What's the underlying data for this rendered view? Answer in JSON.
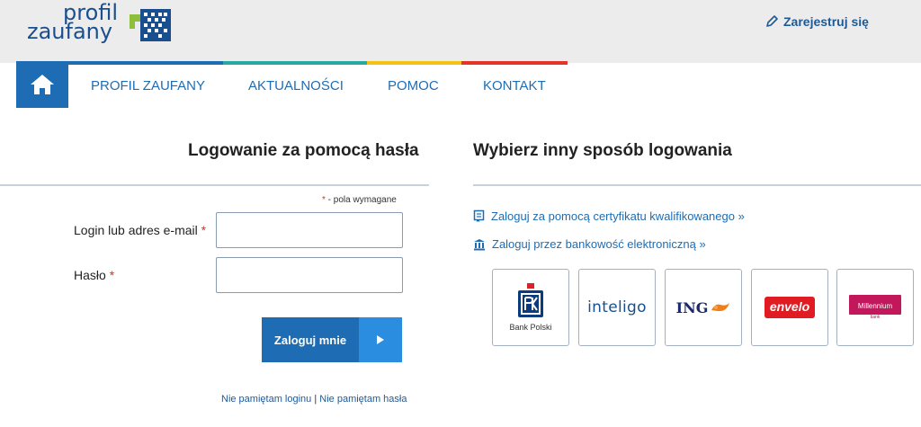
{
  "header": {
    "logo_line1": "profil",
    "logo_line2": "zaufany",
    "register_label": "Zarejestruj się"
  },
  "nav": {
    "items": [
      "PROFIL ZAUFANY",
      "AKTUALNOŚCI",
      "POMOC",
      "KONTAKT"
    ],
    "stripe_colors": [
      "#1e6db4",
      "#27a9a1",
      "#f2c316",
      "#e3352a"
    ]
  },
  "login": {
    "title": "Logowanie za pomocą hasła",
    "required_marker": "*",
    "required_note": " - pola wymagane",
    "login_label": "Login lub adres e-mail",
    "password_label": "Hasło",
    "login_value": "",
    "password_value": "",
    "submit_label": "Zaloguj mnie",
    "forgot_login": "Nie pamiętam loginu",
    "separator": "|",
    "forgot_password": "Nie pamiętam hasła"
  },
  "alternative": {
    "title": "Wybierz inny sposób logowania",
    "certificate_link": "Zaloguj za pomocą certyfikatu kwalifikowanego »",
    "bank_link": "Zaloguj przez bankowość elektroniczną »",
    "banks": [
      {
        "name": "Bank Polski",
        "icon": "pko-logo-icon"
      },
      {
        "name": "inteligo",
        "icon": "inteligo-logo-icon"
      },
      {
        "name": "ING",
        "icon": "ing-lion-icon"
      },
      {
        "name": "envelo",
        "icon": "envelo-logo-icon"
      },
      {
        "name": "Millennium",
        "sub": "bank",
        "icon": "millennium-logo-icon"
      }
    ]
  }
}
